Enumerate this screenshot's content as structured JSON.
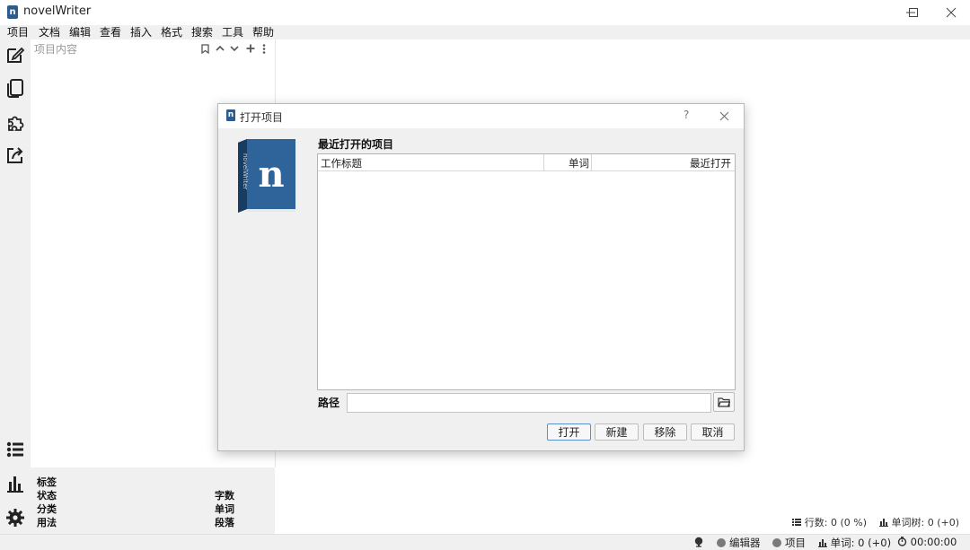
{
  "window": {
    "title": "novelWriter",
    "app_icon_letter": "n"
  },
  "menu": [
    {
      "label": "项目"
    },
    {
      "label": "文档"
    },
    {
      "label": "编辑"
    },
    {
      "label": "查看"
    },
    {
      "label": "插入"
    },
    {
      "label": "格式"
    },
    {
      "label": "搜索"
    },
    {
      "label": "工具"
    },
    {
      "label": "帮助"
    }
  ],
  "toolbar": {
    "top_icons": [
      "edit-icon",
      "copy-pages-icon",
      "puzzle-icon",
      "export-icon"
    ],
    "bottom_icons": [
      "list-icon",
      "bar-chart-icon",
      "gear-icon"
    ]
  },
  "tree": {
    "header": "项目内容"
  },
  "details": {
    "tags_label": "标签",
    "status_label": "状态",
    "class_label": "分类",
    "usage_label": "用法",
    "chars_label": "字数",
    "words_label": "单词",
    "paras_label": "段落"
  },
  "doc": {
    "stats": "行数: 0 (0 %)",
    "tree_words": "单词树: 0 (+0)"
  },
  "statusbar": {
    "editor_label": "编辑器",
    "project_label": "项目",
    "words": "单词: 0 (+0)",
    "timer": "00:00:00"
  },
  "dialog": {
    "title": "打开项目",
    "help": "?",
    "recent_heading": "最近打开的项目",
    "columns": [
      "工作标题",
      "单词",
      "最近打开"
    ],
    "rows": [],
    "path_label": "路径",
    "path_value": "",
    "buttons": {
      "open": "打开",
      "new": "新建",
      "remove": "移除",
      "cancel": "取消"
    },
    "logo_letter": "n",
    "logo_spine_text": "novelWriter"
  },
  "colors": {
    "brand": "#2d5c8c",
    "accent": "#5b8fd0"
  }
}
